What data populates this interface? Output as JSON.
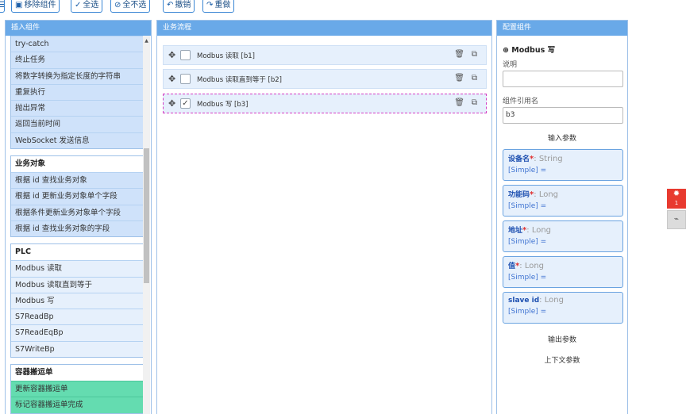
{
  "toolbar": {
    "remove_label": "移除组件",
    "select_all_label": "全选",
    "deselect_all_label": "全不选",
    "undo_label": "撤销",
    "redo_label": "重做"
  },
  "left_panel": {
    "title": "插入组件",
    "control_items": [
      "try-catch",
      "终止任务",
      "将数字转换为指定长度的字符串",
      "重复执行",
      "抛出异常",
      "返回当前时间",
      "WebSocket 发送信息"
    ],
    "business_group": {
      "title": "业务对象",
      "items": [
        "根据 id 查找业务对象",
        "根据 id 更新业务对象单个字段",
        "根据条件更新业务对象单个字段",
        "根据 id 查找业务对象的字段"
      ]
    },
    "plc_group": {
      "title": "PLC",
      "items": [
        "Modbus 读取",
        "Modbus 读取直到等于",
        "Modbus 写",
        "S7ReadBp",
        "S7ReadEqBp",
        "S7WriteBp"
      ]
    },
    "container_group": {
      "title": "容器搬运单",
      "items": [
        "更新容器搬运单",
        "标记容器搬运单完成"
      ]
    }
  },
  "middle_panel": {
    "title": "业务流程",
    "steps": [
      {
        "label": "Modbus 读取 [b1]",
        "checked": false,
        "selected": false
      },
      {
        "label": "Modbus 读取直到等于 [b2]",
        "checked": false,
        "selected": false
      },
      {
        "label": "Modbus 写 [b3]",
        "checked": true,
        "selected": true
      }
    ]
  },
  "right_panel": {
    "title": "配置组件",
    "component_title": "Modbus 写",
    "desc_label": "说明",
    "desc_value": "",
    "ref_label": "组件引用名",
    "ref_value": "b3",
    "input_params_title": "输入参数",
    "params": [
      {
        "name": "设备名",
        "required": true,
        "type": "String",
        "value": "[Simple] ="
      },
      {
        "name": "功能码",
        "required": true,
        "type": "Long",
        "value": "[Simple] ="
      },
      {
        "name": "地址",
        "required": true,
        "type": "Long",
        "value": "[Simple] ="
      },
      {
        "name": "值",
        "required": true,
        "type": "Long",
        "value": "[Simple] ="
      },
      {
        "name": "slave id",
        "required": false,
        "type": "Long",
        "value": "[Simple] ="
      }
    ],
    "output_params_title": "输出参数",
    "context_params_title": "上下文参数"
  },
  "float_badge": "1",
  "colors": {
    "header_blue": "#69a9e8",
    "item_blue": "#cfe2fa",
    "item_green": "#64dcb0",
    "selected_dash": "#d43cc4",
    "required_red": "#e03030"
  }
}
